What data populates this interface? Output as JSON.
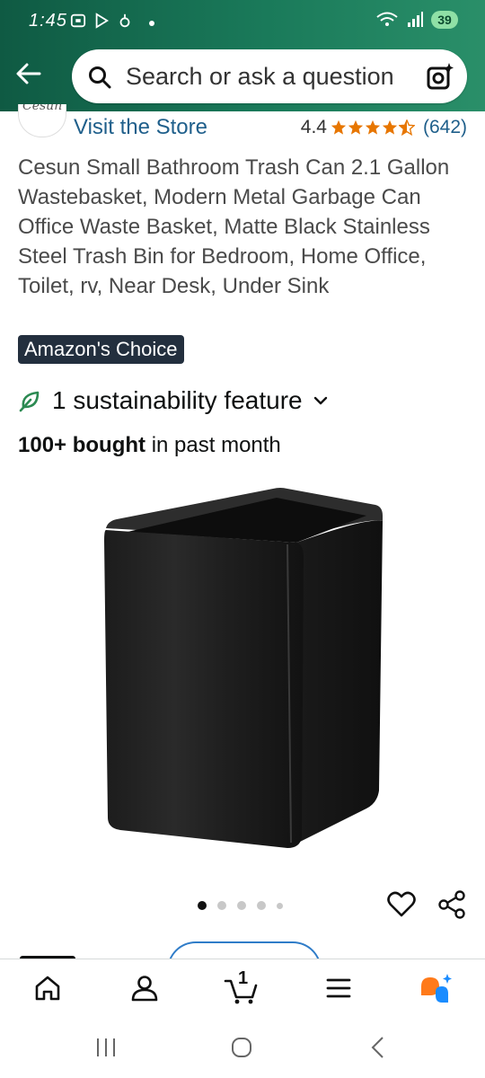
{
  "status_bar": {
    "time": "1:45",
    "battery": "39"
  },
  "header": {
    "search_placeholder": "Search or ask a question"
  },
  "product": {
    "brand_logo_text": "Cesun",
    "visit_store": "Visit the Store",
    "rating": "4.4",
    "stars": 4.5,
    "rating_count": "(642)",
    "title": "Cesun Small Bathroom Trash Can 2.1 Gallon Wastebasket, Modern Metal Garbage Can Office Waste Basket, Matte Black Stainless Steel Trash Bin for Bedroom, Home Office, Toilet, rv, Near Desk, Under Sink",
    "badge": "Amazon's Choice",
    "sustainability": "1 sustainability feature",
    "bought_bold": "100+ bought",
    "bought_rest": " in past month",
    "image_count": 5,
    "active_image": 1
  },
  "bottom_nav": {
    "cart_count": "1",
    "items": [
      "home-icon",
      "account-icon",
      "cart-icon",
      "menu-icon",
      "ai-assistant-icon"
    ]
  },
  "colors": {
    "header_gradient_start": "#0f5a43",
    "link": "#1f5f8b",
    "star": "#e77600",
    "badge_bg": "#232f3e",
    "sustain_green": "#2c8a52"
  }
}
